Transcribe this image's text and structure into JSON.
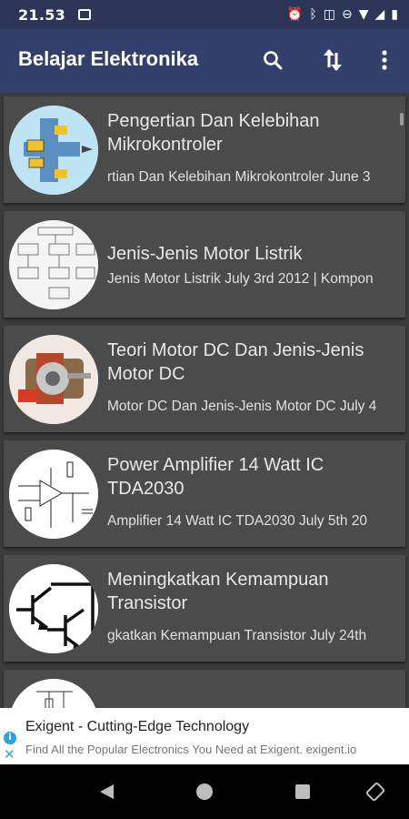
{
  "status": {
    "time": "21.53"
  },
  "appbar": {
    "title": "Belajar Elektronika"
  },
  "articles": [
    {
      "title": "Pengertian Dan Kelebihan Mikrokontroler",
      "subtitle": "rtian Dan Kelebihan Mikrokontroler June 3"
    },
    {
      "title": "Jenis-Jenis Motor Listrik",
      "subtitle": "Jenis Motor Listrik July 3rd 2012 | Kompon"
    },
    {
      "title": "Teori Motor DC Dan Jenis-Jenis Motor DC",
      "subtitle": "Motor DC Dan Jenis-Jenis Motor DC July 4"
    },
    {
      "title": "Power Amplifier 14 Watt IC TDA2030",
      "subtitle": "Amplifier 14 Watt IC TDA2030 July 5th 20"
    },
    {
      "title": "Meningkatkan Kemampuan Transistor",
      "subtitle": "gkatkan Kemampuan Transistor July 24th"
    }
  ],
  "ad": {
    "headline": "Exigent - Cutting-Edge Technology",
    "body": "Find All the Popular Electronics You Need at Exigent. exigent.io"
  },
  "colors": {
    "statusbar": "#2c3457",
    "appbar": "#34406c",
    "card": "#4b4b4b",
    "background": "#3b3b3b"
  }
}
